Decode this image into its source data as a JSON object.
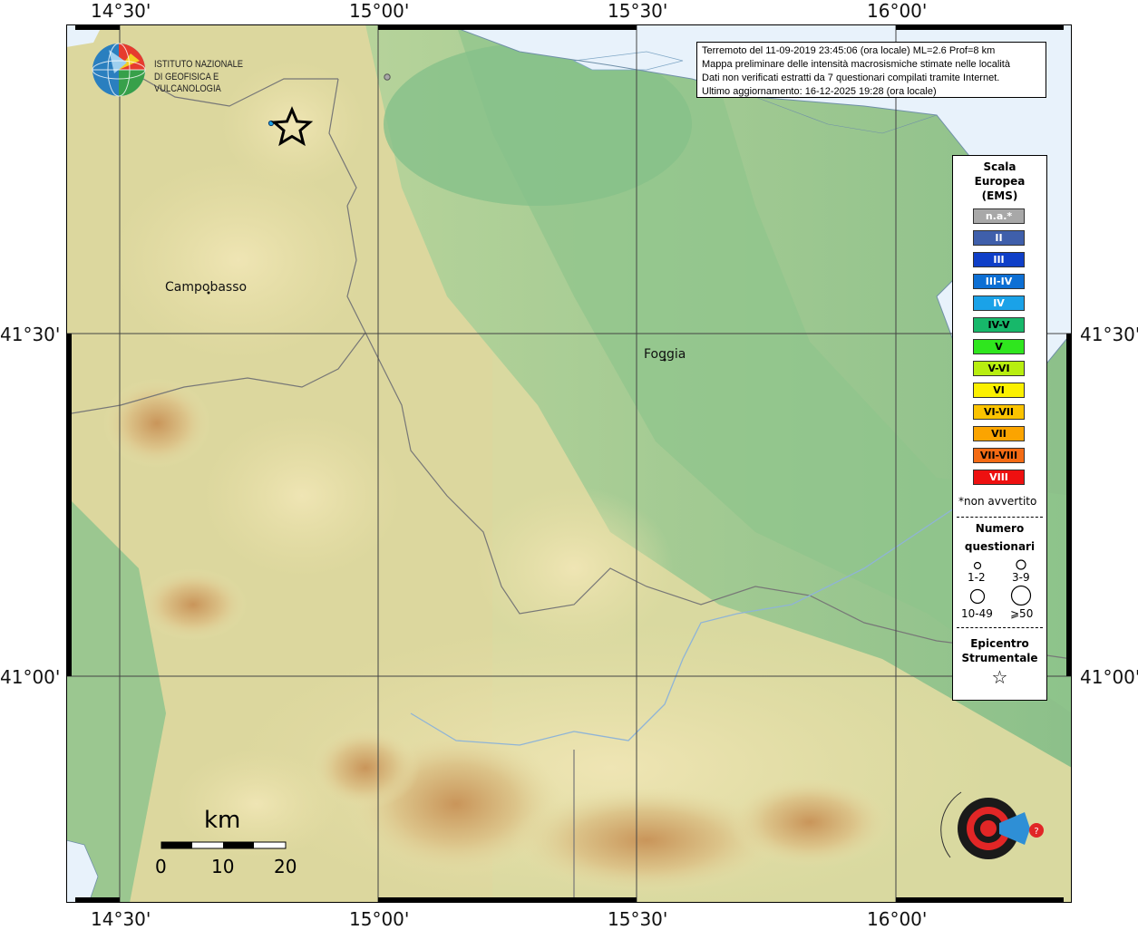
{
  "axes": {
    "top_ticks": [
      "14°30'",
      "15°00'",
      "15°30'",
      "16°00'"
    ],
    "bottom_ticks": [
      "14°30'",
      "15°00'",
      "15°30'",
      "16°00'"
    ],
    "left_ticks": [
      "41°30'",
      "41°00'"
    ],
    "right_ticks": [
      "41°30'",
      "41°00'"
    ]
  },
  "info": {
    "line1": "Terremoto del 11-09-2019 23:45:06 (ora locale) ML=2.6 Prof=8 km",
    "line2": "Mappa preliminare delle intensità macrosismiche stimate nelle località",
    "line3": "Dati non verificati estratti da 7 questionari compilati tramite Internet.",
    "line4": "Ultimo aggiornamento: 16-12-2025 19:28 (ora locale)"
  },
  "logo": {
    "line1": "ISTITUTO NAZIONALE",
    "line2": "DI GEOFISICA E VULCANOLOGIA"
  },
  "places": {
    "campobasso": "Campobasso",
    "foggia": "Foggia"
  },
  "legend": {
    "title1": "Scala",
    "title2": "Europea",
    "title3": "(EMS)",
    "scale": [
      {
        "label": "n.a.*",
        "color": "#a8a8a8",
        "text": "#ffffff"
      },
      {
        "label": "II",
        "color": "#3f5fab",
        "text": "#ffffff"
      },
      {
        "label": "III",
        "color": "#0f3fc8",
        "text": "#ffffff"
      },
      {
        "label": "III-IV",
        "color": "#0d6fd4",
        "text": "#ffffff"
      },
      {
        "label": "IV",
        "color": "#1aa2e8",
        "text": "#ffffff"
      },
      {
        "label": "IV-V",
        "color": "#17b86a",
        "text": "#000000"
      },
      {
        "label": "V",
        "color": "#2fe61e",
        "text": "#000000"
      },
      {
        "label": "V-VI",
        "color": "#b8ee10",
        "text": "#000000"
      },
      {
        "label": "VI",
        "color": "#fbf000",
        "text": "#000000"
      },
      {
        "label": "VI-VII",
        "color": "#fbc300",
        "text": "#000000"
      },
      {
        "label": "VII",
        "color": "#fba400",
        "text": "#000000"
      },
      {
        "label": "VII-VIII",
        "color": "#f46b14",
        "text": "#000000"
      },
      {
        "label": "VIII",
        "color": "#ee1010",
        "text": "#ffffff"
      }
    ],
    "note": "*non avvertito",
    "q_title1": "Numero",
    "q_title2": "questionari",
    "q_sizes": [
      "1-2",
      "3-9",
      "10-49",
      "⩾50"
    ],
    "epi_title1": "Epicentro",
    "epi_title2": "Strumentale",
    "star": "☆"
  },
  "scalebar": {
    "unit": "km",
    "labels": [
      "0",
      "10",
      "20"
    ]
  },
  "colors": {
    "sea": "#e8f2fb",
    "lowland": "#8fc28a",
    "hills": "#e6dfa8",
    "mountains": "#c79a5e"
  }
}
